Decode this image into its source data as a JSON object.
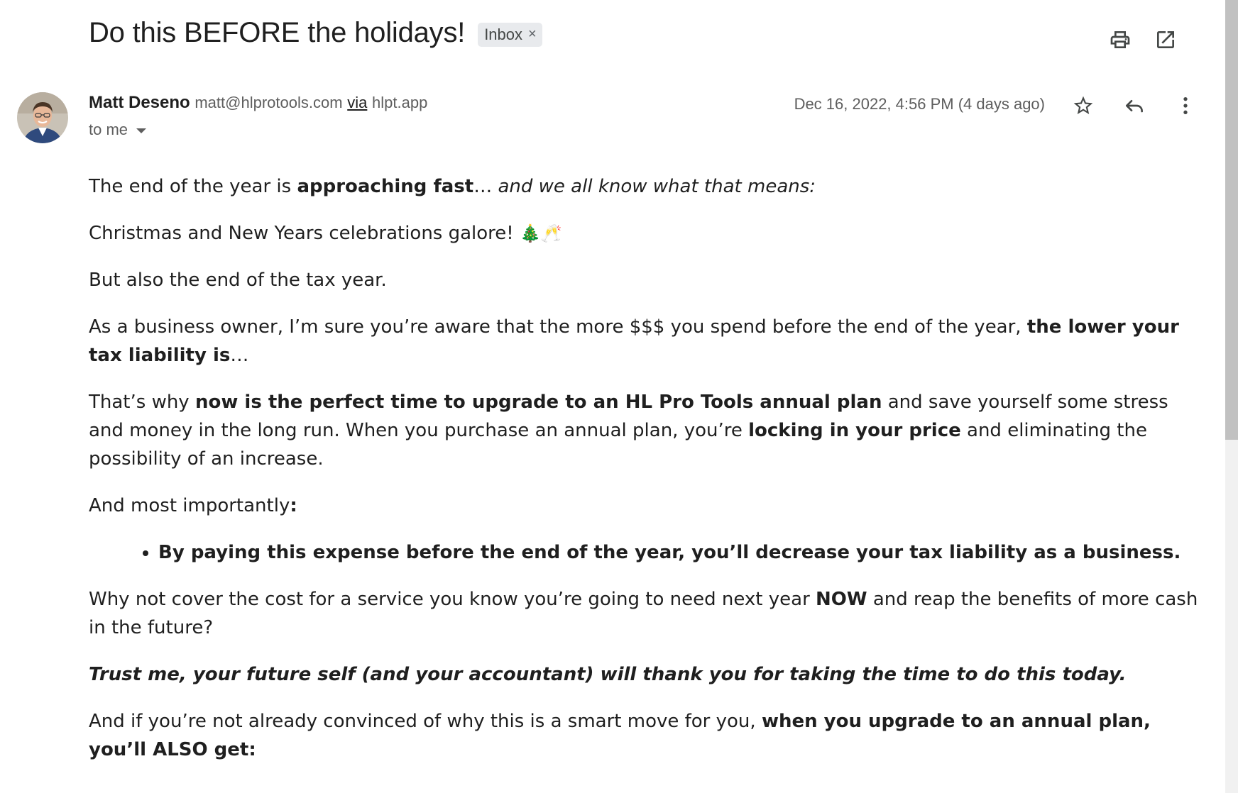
{
  "email": {
    "subject": "Do this BEFORE the holidays!",
    "label": "Inbox",
    "label_remove": "×",
    "icons": [
      "print-icon",
      "open-in-new-window-icon",
      "star-icon",
      "reply-icon",
      "more-vert-icon",
      "dropdown-caret-icon"
    ],
    "sender": {
      "name": "Matt Deseno",
      "email": "matt@hlprotools.com",
      "via": "via",
      "via_domain": "hlpt.app"
    },
    "recipient": "to me",
    "date": "Dec 16, 2022, 4:56 PM (4 days ago)"
  },
  "body": {
    "p1_a": "The end of the year is ",
    "p1_b": "approaching fast",
    "p1_c": "… ",
    "p1_d": "and we all know what that means:",
    "p2_a": "Christmas and New Years celebrations galore! ",
    "p2_emoji": "🎄🥂",
    "p3": "But also the end of the tax year.",
    "p4_a": "As a business owner, I’m sure you’re aware that the more $$$ you spend before the end of the year, ",
    "p4_b": "the lower your tax liability is",
    "p4_c": "…",
    "p5_a": "That’s why ",
    "p5_b": "now is the perfect time to upgrade to an HL Pro Tools annual plan",
    "p5_c": " and save yourself some stress and money in the long run. When you purchase an annual plan, you’re ",
    "p5_d": "locking in your price",
    "p5_e": " and eliminating the possibility of an increase.",
    "p6_a": "And most importantly",
    "p6_b": ":",
    "bullet": "By paying this expense before the end of the year, you’ll decrease your tax liability as a business.",
    "p7_a": "Why not cover the cost for a service you know you’re going to need next year ",
    "p7_b": "NOW",
    "p7_c": " and reap the benefits of more cash in the future?",
    "p8": "Trust me, your future self (and your accountant) will thank you for taking the time to do this today.",
    "p9_a": "And if you’re not already convinced of why this is a smart move for you, ",
    "p9_b": "when you upgrade to an annual plan, you’ll ALSO get:"
  }
}
